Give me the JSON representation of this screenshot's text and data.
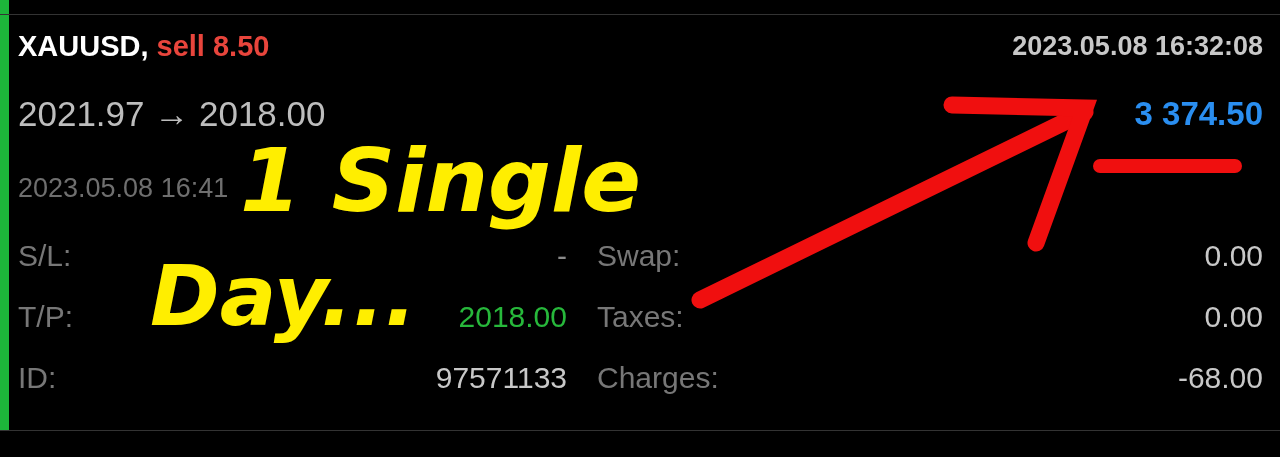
{
  "trade": {
    "symbol": "XAUUSD,",
    "direction": {
      "text": "sell 8.50",
      "kind": "sell"
    },
    "open_time": "2023.05.08 16:32:08",
    "prices": "2021.97 → 2018.00",
    "profit": {
      "text": "3 374.50",
      "kind": "profit"
    },
    "close_time": "2023.05.08 16:41"
  },
  "details": [
    {
      "label": "S/L:",
      "value": "-",
      "kind": "plain",
      "cost_label": "Swap:",
      "cost_value": "0.00"
    },
    {
      "label": "T/P:",
      "value": "2018.00",
      "kind": "target",
      "cost_label": "Taxes:",
      "cost_value": "0.00"
    },
    {
      "label": "ID:",
      "value": "97571133",
      "kind": "id",
      "cost_label": "Charges:",
      "cost_value": "-68.00"
    }
  ],
  "annotation": {
    "lines": [
      "1 Single",
      "Day..."
    ]
  }
}
